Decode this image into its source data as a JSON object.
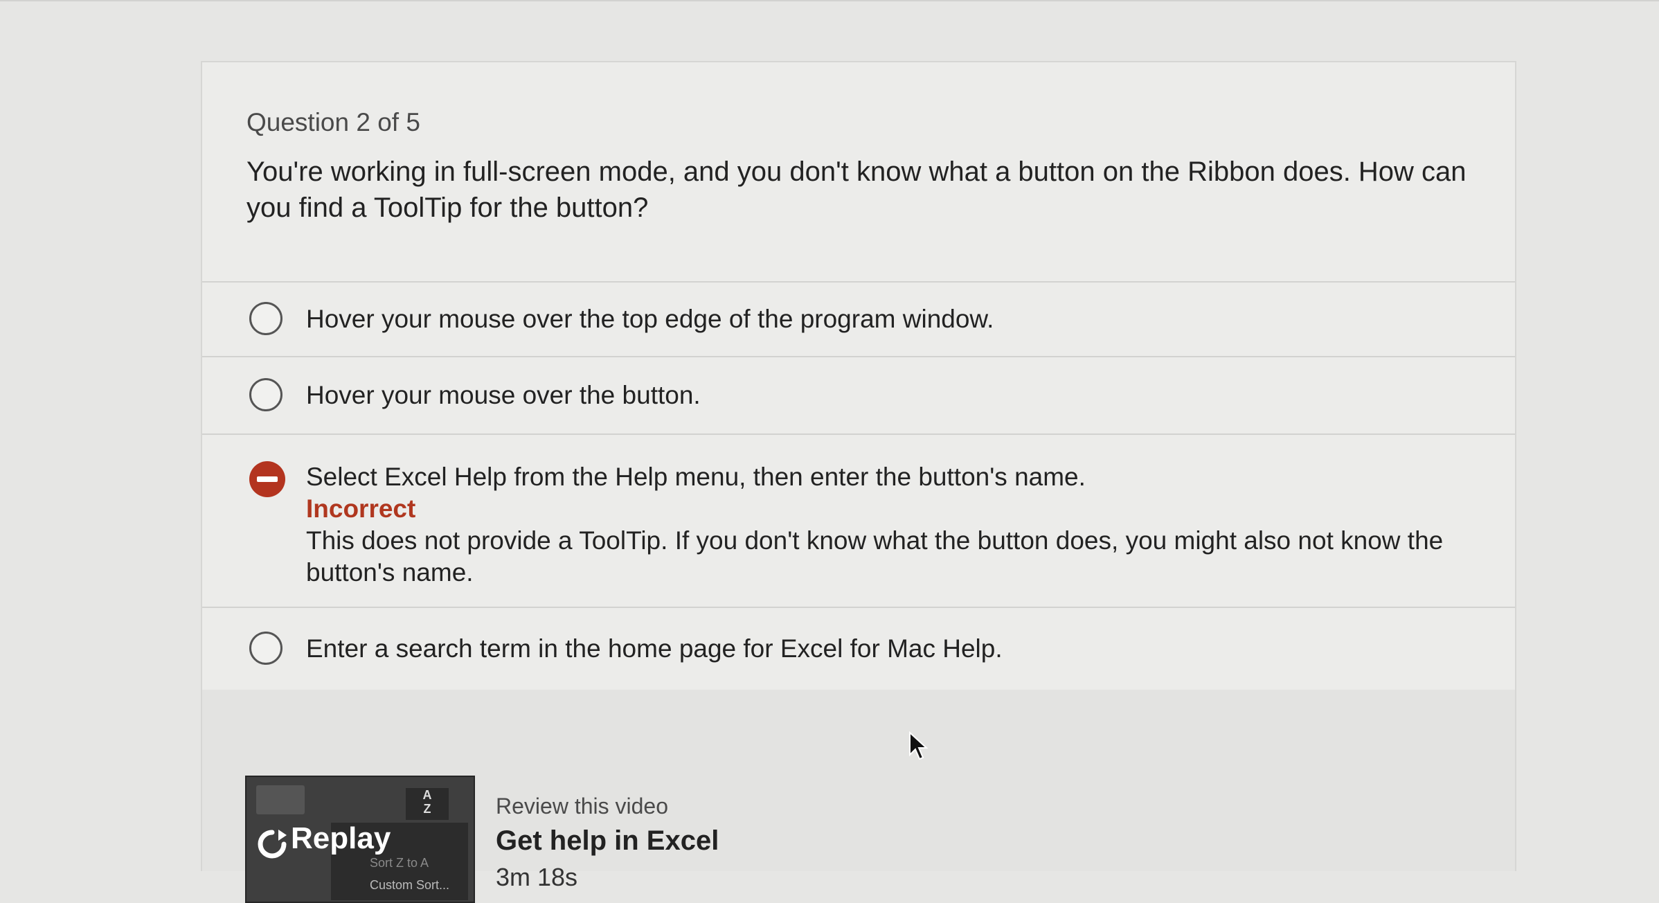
{
  "question": {
    "counter": "Question 2 of 5",
    "text": "You're working in full-screen mode, and you don't know what a button on the Ribbon does. How can you find a ToolTip for the button?"
  },
  "options": [
    {
      "label": "Hover your mouse over the top edge of the program window.",
      "state": "unselected"
    },
    {
      "label": "Hover your mouse over the button.",
      "state": "unselected"
    },
    {
      "label": "Select Excel Help from the Help menu, then enter the button's name.",
      "state": "incorrect",
      "feedback_status": "Incorrect",
      "feedback_text": "This does not provide a ToolTip. If you don't know what the button does, you might also not know the button's name."
    },
    {
      "label": "Enter a search term in the home page for Excel for Mac Help.",
      "state": "unselected"
    }
  ],
  "review": {
    "caption": "Review this video",
    "title": "Get help in Excel",
    "duration": "3m 18s",
    "thumbnail": {
      "replay_label": "Replay",
      "menu_item_1": "Sort Z to A",
      "menu_item_2": "Custom Sort...",
      "sort_icon_text": "A\nZ"
    }
  },
  "colors": {
    "incorrect": "#b0371f",
    "background": "#e6e6e4",
    "card": "#ececea"
  },
  "icons": {
    "radio": "radio-circle-icon",
    "incorrect": "no-entry-icon",
    "replay": "replay-icon",
    "cursor": "mouse-pointer-icon"
  }
}
